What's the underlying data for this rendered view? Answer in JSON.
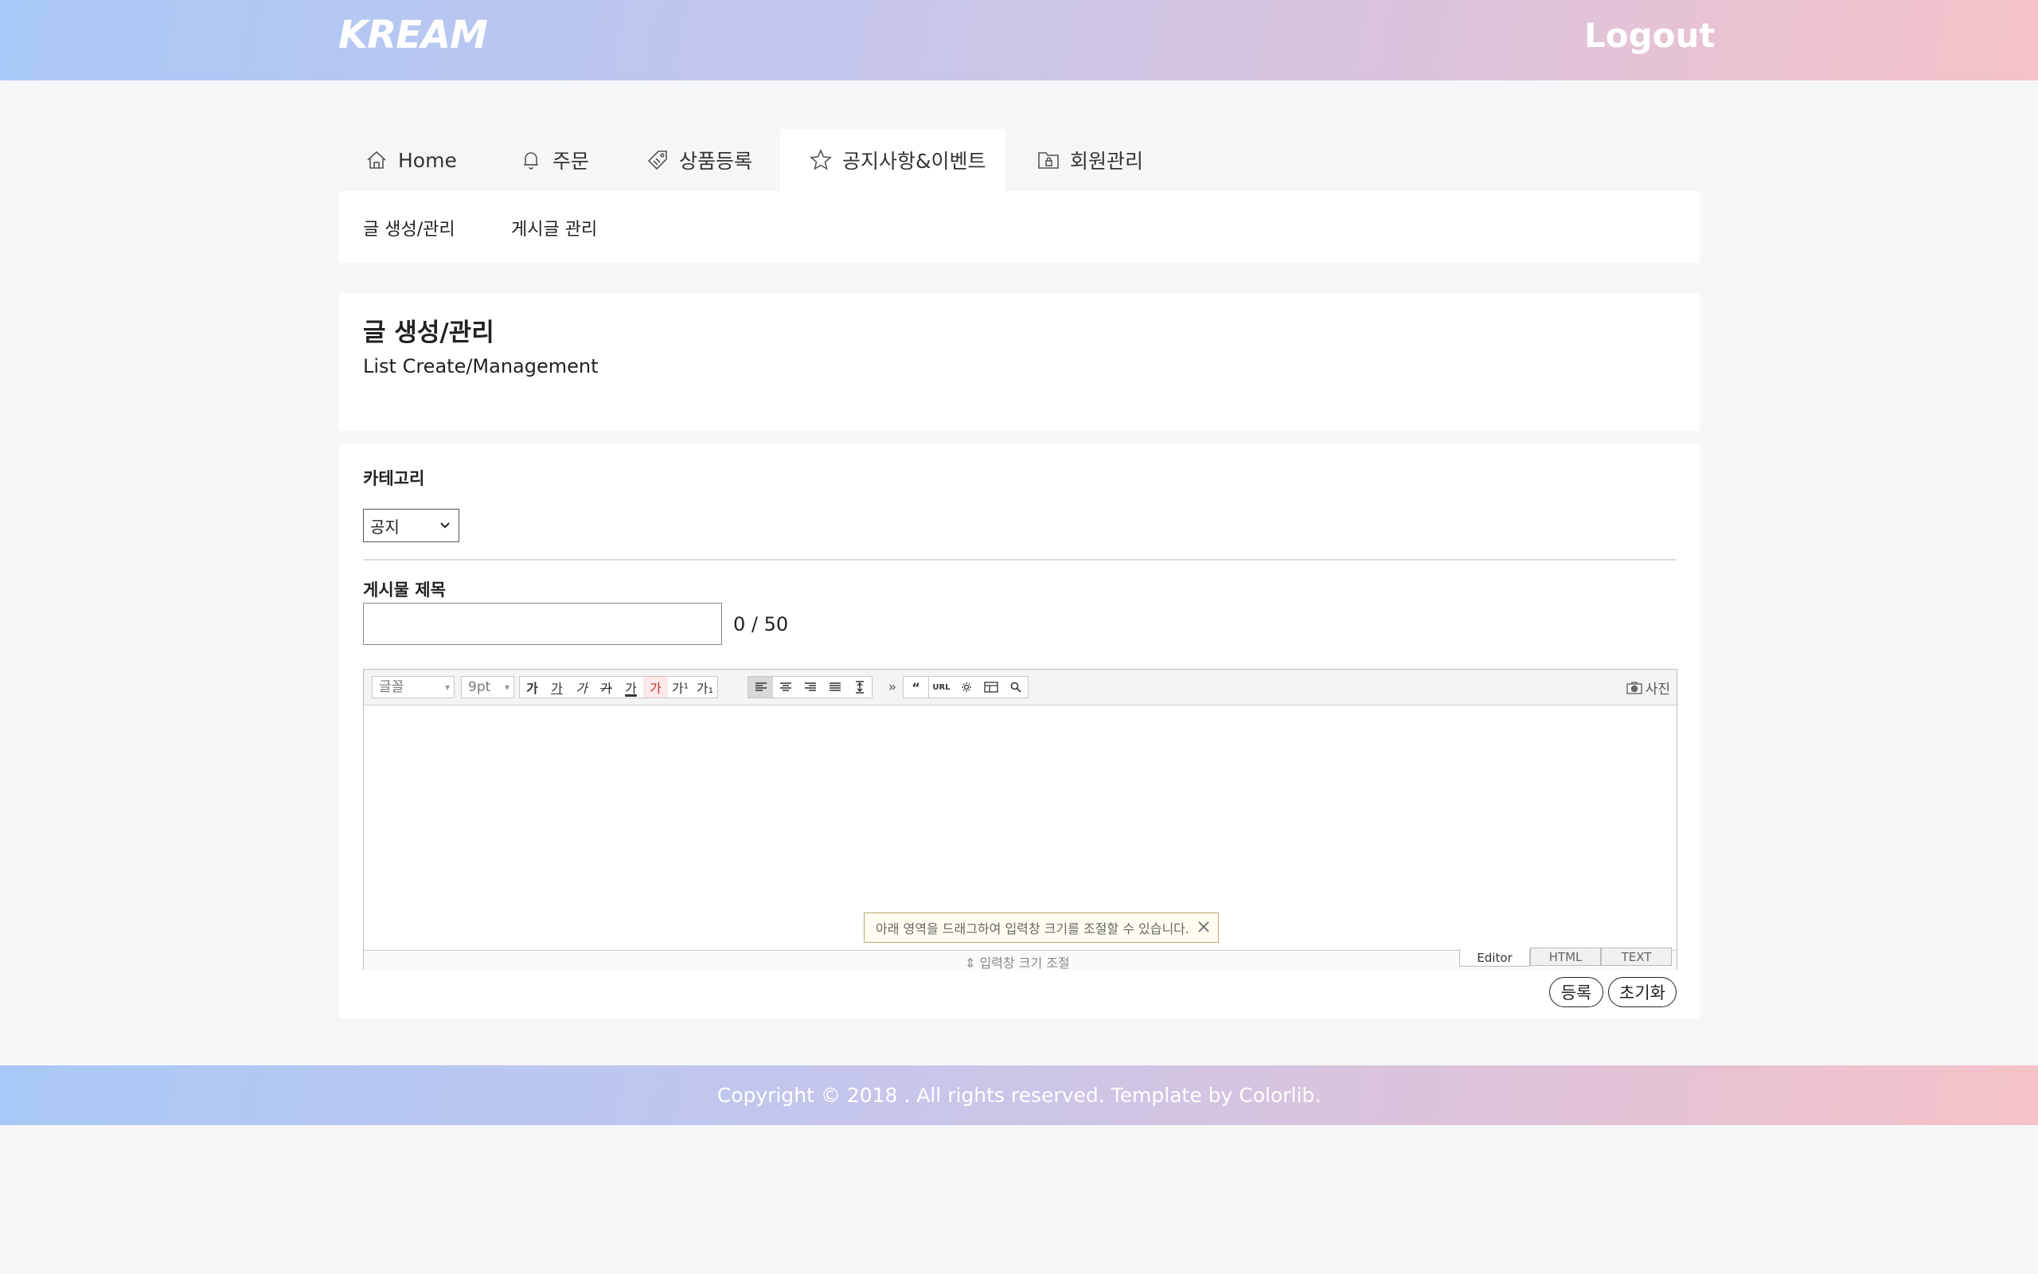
{
  "header": {
    "logo": "KREAM",
    "logout": "Logout"
  },
  "tabs": [
    {
      "label": "Home",
      "icon": "home-icon"
    },
    {
      "label": "주문",
      "icon": "bell-icon"
    },
    {
      "label": "상품등록",
      "icon": "tag-icon"
    },
    {
      "label": "공지사항&이벤트",
      "icon": "star-icon",
      "active": true
    },
    {
      "label": "회원관리",
      "icon": "lock-folder-icon"
    }
  ],
  "subnav": [
    "글 생성/관리",
    "게시글 관리"
  ],
  "page": {
    "title": "글 생성/관리",
    "subtitle": "List Create/Management"
  },
  "form": {
    "category_label": "카테고리",
    "category_value": "공지",
    "title_label": "게시물 제목",
    "title_value": "",
    "counter": "0 / 50"
  },
  "editor": {
    "font_select": "글꼴",
    "size_select": "9pt",
    "text_buttons": [
      "가",
      "가",
      "가",
      "가",
      "가",
      "가",
      "가¹",
      "가₁"
    ],
    "photo_label": "사진",
    "resize_tip": "아래 영역을 드래그하여 입력창 크기를 조절할 수 있습니다.",
    "resize_handle": "입력창 크기 조절",
    "modes": [
      "Editor",
      "HTML",
      "TEXT"
    ],
    "active_mode": "Editor"
  },
  "buttons": {
    "submit": "등록",
    "reset": "초기화"
  },
  "footer": {
    "copyright": "Copyright © 2018 . All rights reserved. Template by Colorlib."
  },
  "colors": {
    "gradient_start": "#a9c8f7",
    "gradient_end": "#f5c3c8",
    "page_bg": "#f5f6f8"
  }
}
